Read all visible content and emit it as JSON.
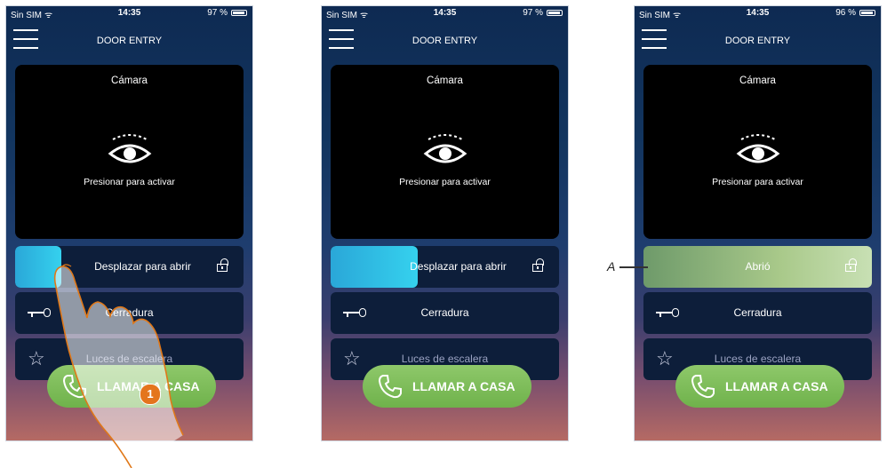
{
  "status": {
    "carrier": "Sin SIM",
    "time": "14:35",
    "battery": [
      "97 %",
      "97 %",
      "96 %"
    ]
  },
  "app": {
    "title": "DOOR ENTRY"
  },
  "camera": {
    "title": "Cámara",
    "hint": "Presionar para activar"
  },
  "actions": {
    "slide_label": "Desplazar para abrir",
    "opened_label": "Abrió",
    "lock_label": "Cerradura",
    "stairs_label": "Luces de escalera"
  },
  "call": {
    "label": "LLAMAR A CASA"
  },
  "annotations": {
    "step": "1",
    "callout": "A"
  }
}
